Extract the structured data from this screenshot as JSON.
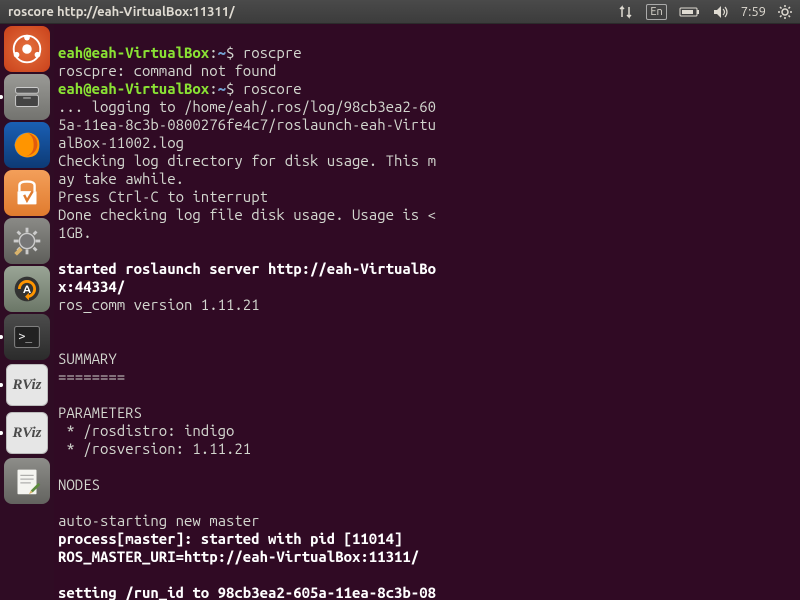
{
  "topbar": {
    "title": "roscore http://eah-VirtualBox:11311/",
    "lang": "En",
    "time": "7:59"
  },
  "launcher": {
    "rviz_label": "RViz"
  },
  "terminal": {
    "prompt_user": "eah@eah-VirtualBox",
    "prompt_sep": ":",
    "prompt_path": "~",
    "prompt_end": "$ ",
    "cmd1": "roscpre",
    "err1": "roscpre: command not found",
    "cmd2": "roscore",
    "log1": "... logging to /home/eah/.ros/log/98cb3ea2-60",
    "log2": "5a-11ea-8c3b-0800276fe4c7/roslaunch-eah-Virtu",
    "log3": "alBox-11002.log",
    "log4": "Checking log directory for disk usage. This m",
    "log5": "ay take awhile.",
    "log6": "Press Ctrl-C to interrupt",
    "log7": "Done checking log file disk usage. Usage is <",
    "log8": "1GB.",
    "started1": "started roslaunch server http://eah-VirtualBo",
    "started2": "x:44334/",
    "roscomm": "ros_comm version 1.11.21",
    "summary": "SUMMARY",
    "summary_ul": "========",
    "params_h": "PARAMETERS",
    "param1": " * /rosdistro: indigo",
    "param2": " * /rosversion: 1.11.21",
    "nodes_h": "NODES",
    "auto": "auto-starting new master",
    "proc": "process[master]: started with pid [11014]",
    "master_uri": "ROS_MASTER_URI=http://eah-VirtualBox:11311/",
    "runid": "setting /run_id to 98cb3ea2-605a-11ea-8c3b-08"
  }
}
